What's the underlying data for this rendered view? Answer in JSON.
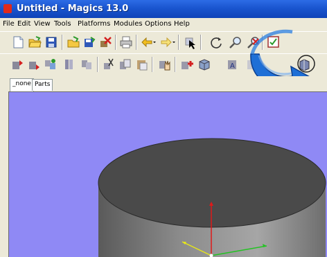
{
  "window": {
    "title": "Untitled - Magics 13.0"
  },
  "menu": [
    "File",
    "Edit",
    "View",
    "Tools",
    "Platforms",
    "Modules",
    "Options",
    "Help"
  ],
  "toolbar_row1": [
    "new-file-icon",
    "open-folder-icon",
    "save-icon",
    "open-part-icon",
    "save-part-icon",
    "remove-part-icon",
    "print-icon",
    "undo-icon",
    "redo-icon",
    "select-icon",
    "rotate-icon",
    "zoom-icon",
    "zoom-cancel-icon",
    "checklist-icon"
  ],
  "toolbar_row2": [
    "import-part-icon",
    "export-part-icon",
    "duplicate-part-icon",
    "part-list-icon",
    "merge-icon",
    "cut-icon",
    "copy-icon",
    "paste-icon",
    "hand-icon",
    "add-part-icon",
    "shell-icon",
    "fix-wizard-icon",
    "view-icon",
    "unload-part-icon"
  ],
  "tabs": {
    "none": "_none",
    "parts": "Parts"
  },
  "colors": {
    "viewport_bg": "#8f89f5",
    "part_top": "#4a4a4a",
    "part_side": "#8c8c8c",
    "axis_x": "#22c322",
    "axis_y": "#e6e619",
    "axis_z": "#e01919",
    "highlight_arrow": "#1e6fd6"
  }
}
